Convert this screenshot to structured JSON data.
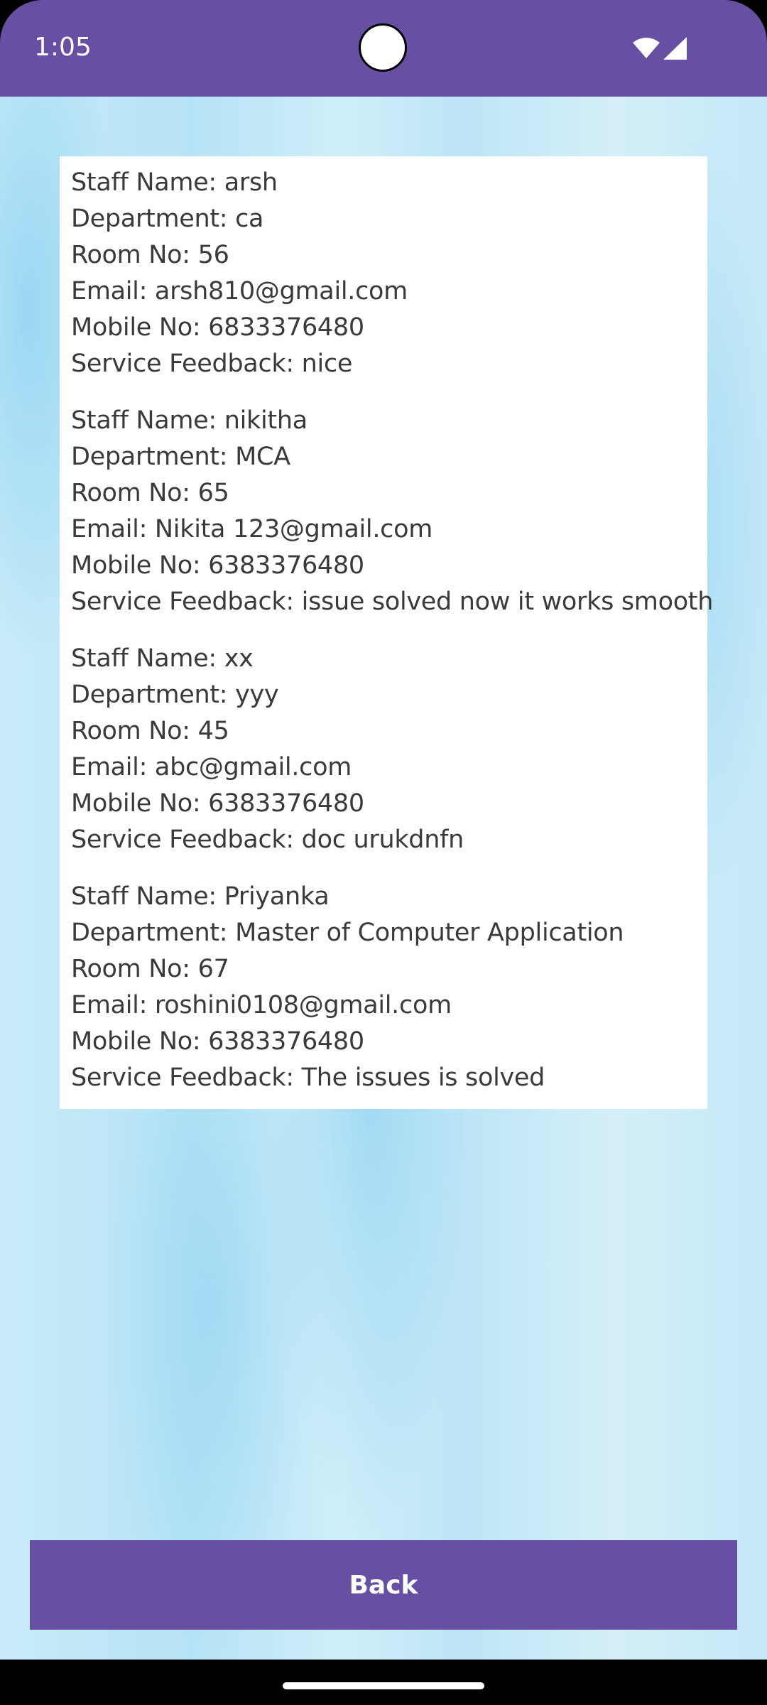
{
  "status_bar": {
    "time": "1:05",
    "icons": [
      "wifi-icon",
      "signal-icon",
      "camera-cutout"
    ],
    "color": "#6750A4"
  },
  "entries": [
    {
      "staff_name": "Staff Name: arsh",
      "department": "Department: ca",
      "room_no": "Room No: 56",
      "email": "Email: arsh810@gmail.com",
      "mobile_no": "Mobile No: 6833376480",
      "service_feedback": "Service Feedback: nice"
    },
    {
      "staff_name": "Staff Name: nikitha",
      "department": "Department: MCA",
      "room_no": "Room No: 65",
      "email": "Email: Nikita 123@gmail.com",
      "mobile_no": "Mobile No: 6383376480",
      "service_feedback": "Service Feedback: issue solved now it works smooth"
    },
    {
      "staff_name": "Staff Name: xx",
      "department": "Department: yyy",
      "room_no": "Room No: 45",
      "email": "Email: abc@gmail.com",
      "mobile_no": "Mobile No: 6383376480",
      "service_feedback": "Service Feedback: doc urukdnfn"
    },
    {
      "staff_name": "Staff Name: Priyanka",
      "department": "Department: Master of Computer Application",
      "room_no": "Room No: 67",
      "email": "Email: roshini0108@gmail.com",
      "mobile_no": "Mobile No: 6383376480",
      "service_feedback": "Service Feedback: The issues is solved"
    }
  ],
  "back_button": {
    "label": "Back",
    "color": "#6750A4"
  }
}
